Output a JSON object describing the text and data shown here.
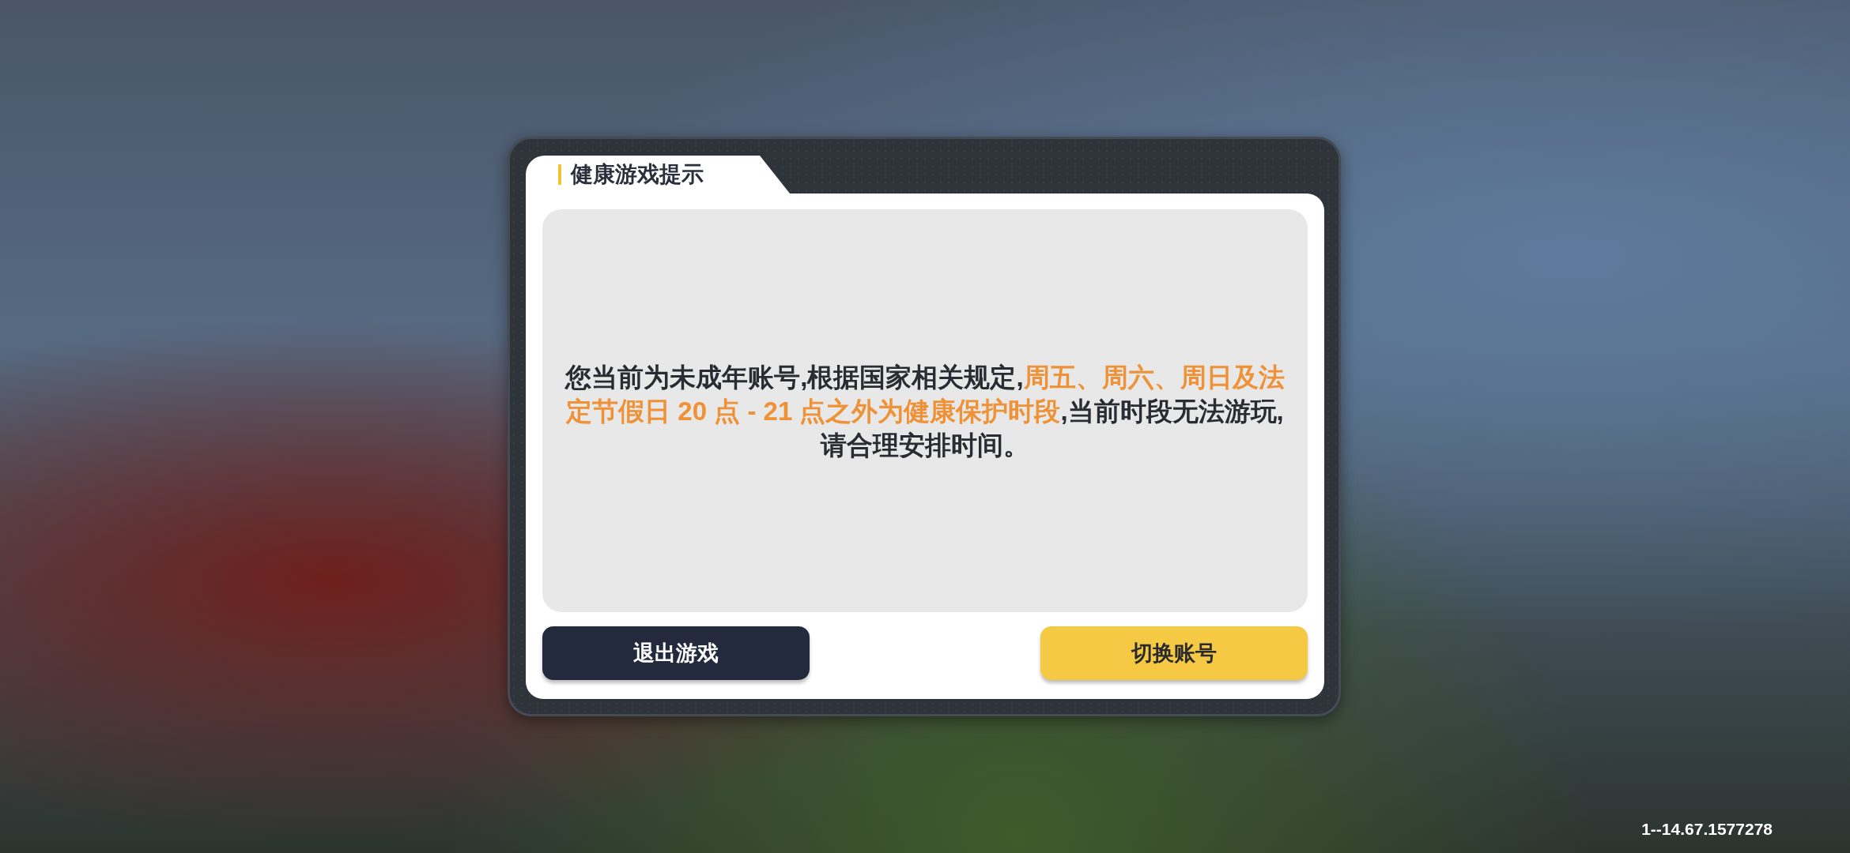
{
  "dialog": {
    "title": "健康游戏提示",
    "message": [
      {
        "text": "您当前为未成年账号,根据国家相关规定,",
        "highlight": false
      },
      {
        "text": "周五、周六、周日及法定节假日 20 点 - 21 点之外为健康保护时段",
        "highlight": true
      },
      {
        "text": ",当前时段无法游玩,请合理安排时间。",
        "highlight": false
      }
    ],
    "buttons": [
      {
        "label": "退出游戏",
        "kind": "secondary"
      },
      {
        "label": "切换账号",
        "kind": "primary"
      }
    ]
  },
  "version": "1--14.67.1577278"
}
